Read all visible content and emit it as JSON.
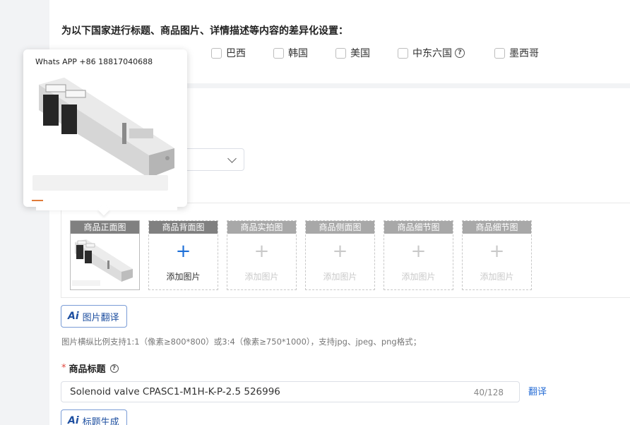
{
  "section": {
    "title": "为以下国家进行标题、商品图片、详情描述等内容的差异化设置："
  },
  "countries": [
    {
      "label": "巴西",
      "checked": false
    },
    {
      "label": "韩国",
      "checked": false
    },
    {
      "label": "美国",
      "checked": false
    },
    {
      "label": "中东六国",
      "checked": false,
      "help_icon": "question-circle-icon"
    },
    {
      "label": "墨西哥",
      "checked": false
    }
  ],
  "popover": {
    "caption": "Whats APP +86 18817040688"
  },
  "image_slots": [
    {
      "label": "商品正面图",
      "filled": true
    },
    {
      "label": "商品背面图",
      "plus": "+",
      "add_text": "添加图片",
      "active": true
    },
    {
      "label": "商品实拍图",
      "plus": "+",
      "add_text": "添加图片",
      "active": false
    },
    {
      "label": "商品侧面图",
      "plus": "+",
      "add_text": "添加图片",
      "active": false
    },
    {
      "label": "商品细节图",
      "plus": "+",
      "add_text": "添加图片",
      "active": false
    },
    {
      "label": "商品细节图",
      "plus": "+",
      "add_text": "添加图片",
      "active": false
    }
  ],
  "buttons": {
    "ai_mark": "Ai",
    "image_translate": "图片翻译",
    "title_generate": "标题生成"
  },
  "hint": "图片横纵比例支持1:1（像素≥800*800）或3:4（像素≥750*1000），支持jpg、jpeg、png格式；",
  "product_title": {
    "required_mark": "*",
    "label": "商品标题",
    "value": "Solenoid valve CPASC1-M1H-K-P-2.5 526996",
    "counter": "40/128",
    "translate": "翻译"
  },
  "colors": {
    "accent_blue": "#2a6fd6",
    "required_red": "#e0473f",
    "slot_header": "#808080"
  }
}
